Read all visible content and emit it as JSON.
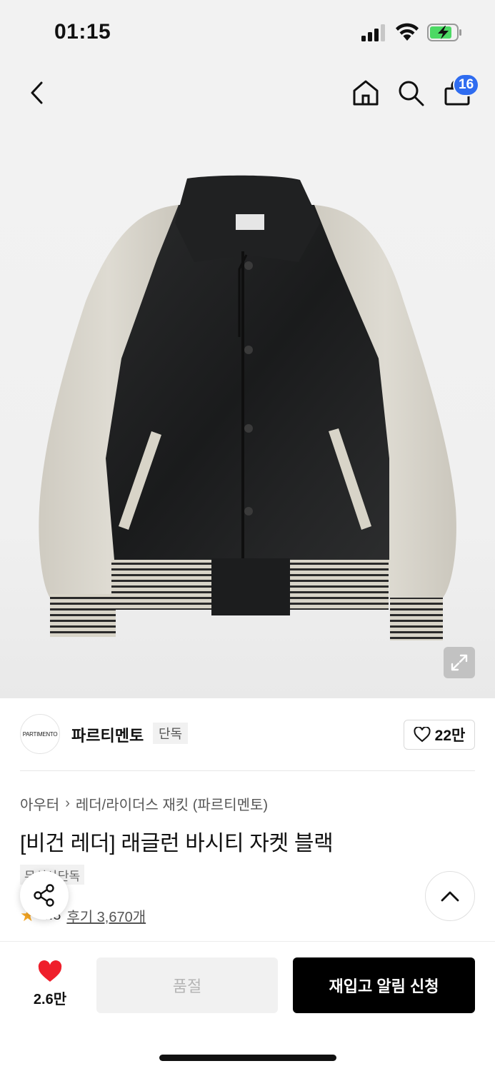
{
  "status_bar": {
    "time": "01:15"
  },
  "top_nav": {
    "cart_count": "16"
  },
  "brand": {
    "logo_text": "PARTIMENTO",
    "name": "파르티멘토",
    "tag": "단독",
    "likes": "22만"
  },
  "product": {
    "breadcrumb_category": "아우터",
    "breadcrumb_subcategory": "레더/라이더스 재킷 (파르티멘토)",
    "title": "[비건 레더] 래글런 바시티 자켓 블랙",
    "exclusive_tag": "무신사단독",
    "rating": "4.8",
    "reviews": "후기 3,670개"
  },
  "bottom_bar": {
    "wish_count": "2.6만",
    "soldout_label": "품절",
    "restock_label": "재입고 알림 신청"
  },
  "colors": {
    "accent_blue": "#2f6cf0",
    "heart_red": "#ef1f2b",
    "star_orange": "#f5a623"
  }
}
